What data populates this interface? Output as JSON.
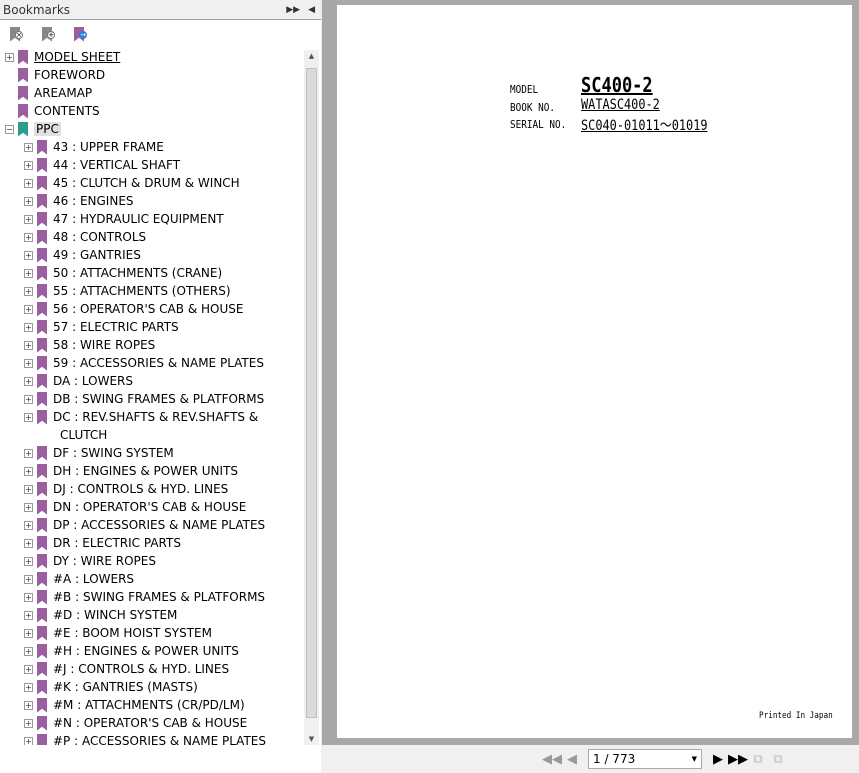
{
  "panel": {
    "title": "Bookmarks"
  },
  "tree": [
    {
      "label": "MODEL SHEET",
      "level": 1,
      "exp": "+",
      "color": "#9b5fa0",
      "u": true
    },
    {
      "label": "FOREWORD",
      "level": 1,
      "exp": "",
      "color": "#9b5fa0"
    },
    {
      "label": "AREAMAP",
      "level": 1,
      "exp": "",
      "color": "#9b5fa0"
    },
    {
      "label": "CONTENTS",
      "level": 1,
      "exp": "",
      "color": "#9b5fa0"
    },
    {
      "label": "PPC",
      "level": 1,
      "exp": "-",
      "color": "#2a9d8f",
      "sel": true
    },
    {
      "label": "43 : UPPER FRAME",
      "level": 2
    },
    {
      "label": "44 : VERTICAL SHAFT",
      "level": 2
    },
    {
      "label": "45 : CLUTCH & DRUM & WINCH",
      "level": 2
    },
    {
      "label": "46 : ENGINES",
      "level": 2
    },
    {
      "label": "47 : HYDRAULIC EQUIPMENT",
      "level": 2
    },
    {
      "label": "48 : CONTROLS",
      "level": 2
    },
    {
      "label": "49 : GANTRIES",
      "level": 2
    },
    {
      "label": "50 : ATTACHMENTS (CRANE)",
      "level": 2
    },
    {
      "label": "55 : ATTACHMENTS (OTHERS)",
      "level": 2
    },
    {
      "label": "56 : OPERATOR'S CAB & HOUSE",
      "level": 2
    },
    {
      "label": "57 : ELECTRIC PARTS",
      "level": 2
    },
    {
      "label": "58 : WIRE ROPES",
      "level": 2
    },
    {
      "label": "59 : ACCESSORIES & NAME PLATES",
      "level": 2
    },
    {
      "label": "DA : LOWERS",
      "level": 2
    },
    {
      "label": "DB : SWING FRAMES & PLATFORMS",
      "level": 2
    },
    {
      "label": "DC : REV.SHAFTS & REV.SHAFTS &",
      "level": 2
    },
    {
      "label": "CLUTCH",
      "level": 2,
      "cont": true
    },
    {
      "label": "DF : SWING SYSTEM",
      "level": 2
    },
    {
      "label": "DH : ENGINES & POWER UNITS",
      "level": 2
    },
    {
      "label": "DJ : CONTROLS & HYD. LINES",
      "level": 2
    },
    {
      "label": "DN : OPERATOR'S CAB & HOUSE",
      "level": 2
    },
    {
      "label": "DP : ACCESSORIES & NAME PLATES",
      "level": 2
    },
    {
      "label": "DR : ELECTRIC PARTS",
      "level": 2
    },
    {
      "label": "DY : WIRE ROPES",
      "level": 2
    },
    {
      "label": "#A : LOWERS",
      "level": 2
    },
    {
      "label": "#B : SWING FRAMES & PLATFORMS",
      "level": 2
    },
    {
      "label": "#D : WINCH SYSTEM",
      "level": 2
    },
    {
      "label": "#E : BOOM HOIST SYSTEM",
      "level": 2
    },
    {
      "label": "#H : ENGINES & POWER UNITS",
      "level": 2
    },
    {
      "label": "#J : CONTROLS & HYD. LINES",
      "level": 2
    },
    {
      "label": "#K : GANTRIES (MASTS)",
      "level": 2
    },
    {
      "label": "#M : ATTACHMENTS (CR/PD/LM)",
      "level": 2
    },
    {
      "label": "#N : OPERATOR'S CAB & HOUSE",
      "level": 2
    },
    {
      "label": "#P : ACCESSORIES & NAME PLATES",
      "level": 2
    }
  ],
  "doc": {
    "model_label": "MODEL",
    "model": "SC400-2",
    "book_label": "BOOK NO.",
    "book": "WATASC400-2",
    "serial_label": "SERIAL NO.",
    "serial": "SC040-01011～01019",
    "footer": "Printed In Japan"
  },
  "nav": {
    "page": "1 / 773"
  }
}
